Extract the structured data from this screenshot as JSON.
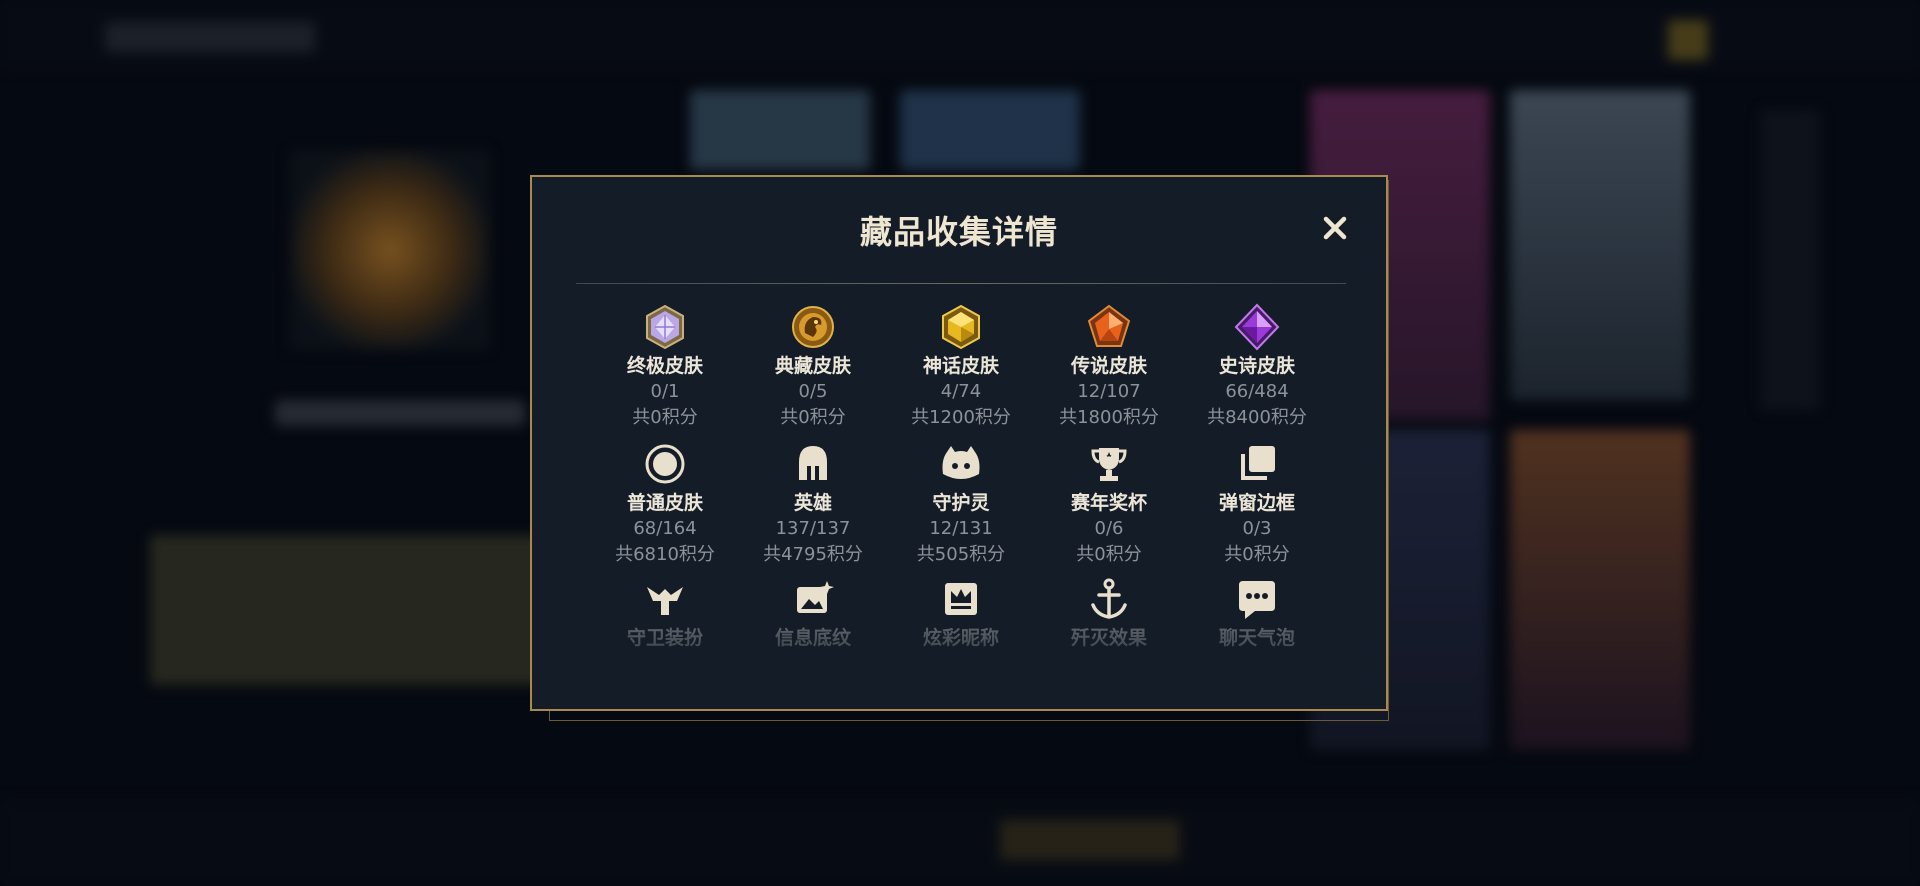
{
  "modal": {
    "title": "藏品收集详情",
    "close_label": "✕"
  },
  "items": [
    {
      "label": "终极皮肤",
      "count": "0/1",
      "points": "共0积分",
      "icon": "ultimate-skin-icon"
    },
    {
      "label": "典藏皮肤",
      "count": "0/5",
      "points": "共0积分",
      "icon": "prestige-skin-icon"
    },
    {
      "label": "神话皮肤",
      "count": "4/74",
      "points": "共1200积分",
      "icon": "mythic-skin-icon"
    },
    {
      "label": "传说皮肤",
      "count": "12/107",
      "points": "共1800积分",
      "icon": "legendary-skin-icon"
    },
    {
      "label": "史诗皮肤",
      "count": "66/484",
      "points": "共8400积分",
      "icon": "epic-skin-icon"
    },
    {
      "label": "普通皮肤",
      "count": "68/164",
      "points": "共6810积分",
      "icon": "common-skin-icon"
    },
    {
      "label": "英雄",
      "count": "137/137",
      "points": "共4795积分",
      "icon": "champion-helmet-icon"
    },
    {
      "label": "守护灵",
      "count": "12/131",
      "points": "共505积分",
      "icon": "guardian-icon"
    },
    {
      "label": "赛年奖杯",
      "count": "0/6",
      "points": "共0积分",
      "icon": "trophy-icon"
    },
    {
      "label": "弹窗边框",
      "count": "0/3",
      "points": "共0积分",
      "icon": "popup-frame-icon"
    },
    {
      "label": "守卫装扮",
      "icon": "ward-skin-icon"
    },
    {
      "label": "信息底纹",
      "icon": "info-card-icon"
    },
    {
      "label": "炫彩昵称",
      "icon": "nickname-crown-icon"
    },
    {
      "label": "歼灭效果",
      "icon": "ace-effect-icon"
    },
    {
      "label": "聊天气泡",
      "icon": "chat-bubble-icon"
    }
  ],
  "colors": {
    "frame_gold": "#a8894f",
    "modal_bg": "#141c27",
    "title_text": "#efe6d2",
    "muted_text": "#8d929a"
  }
}
